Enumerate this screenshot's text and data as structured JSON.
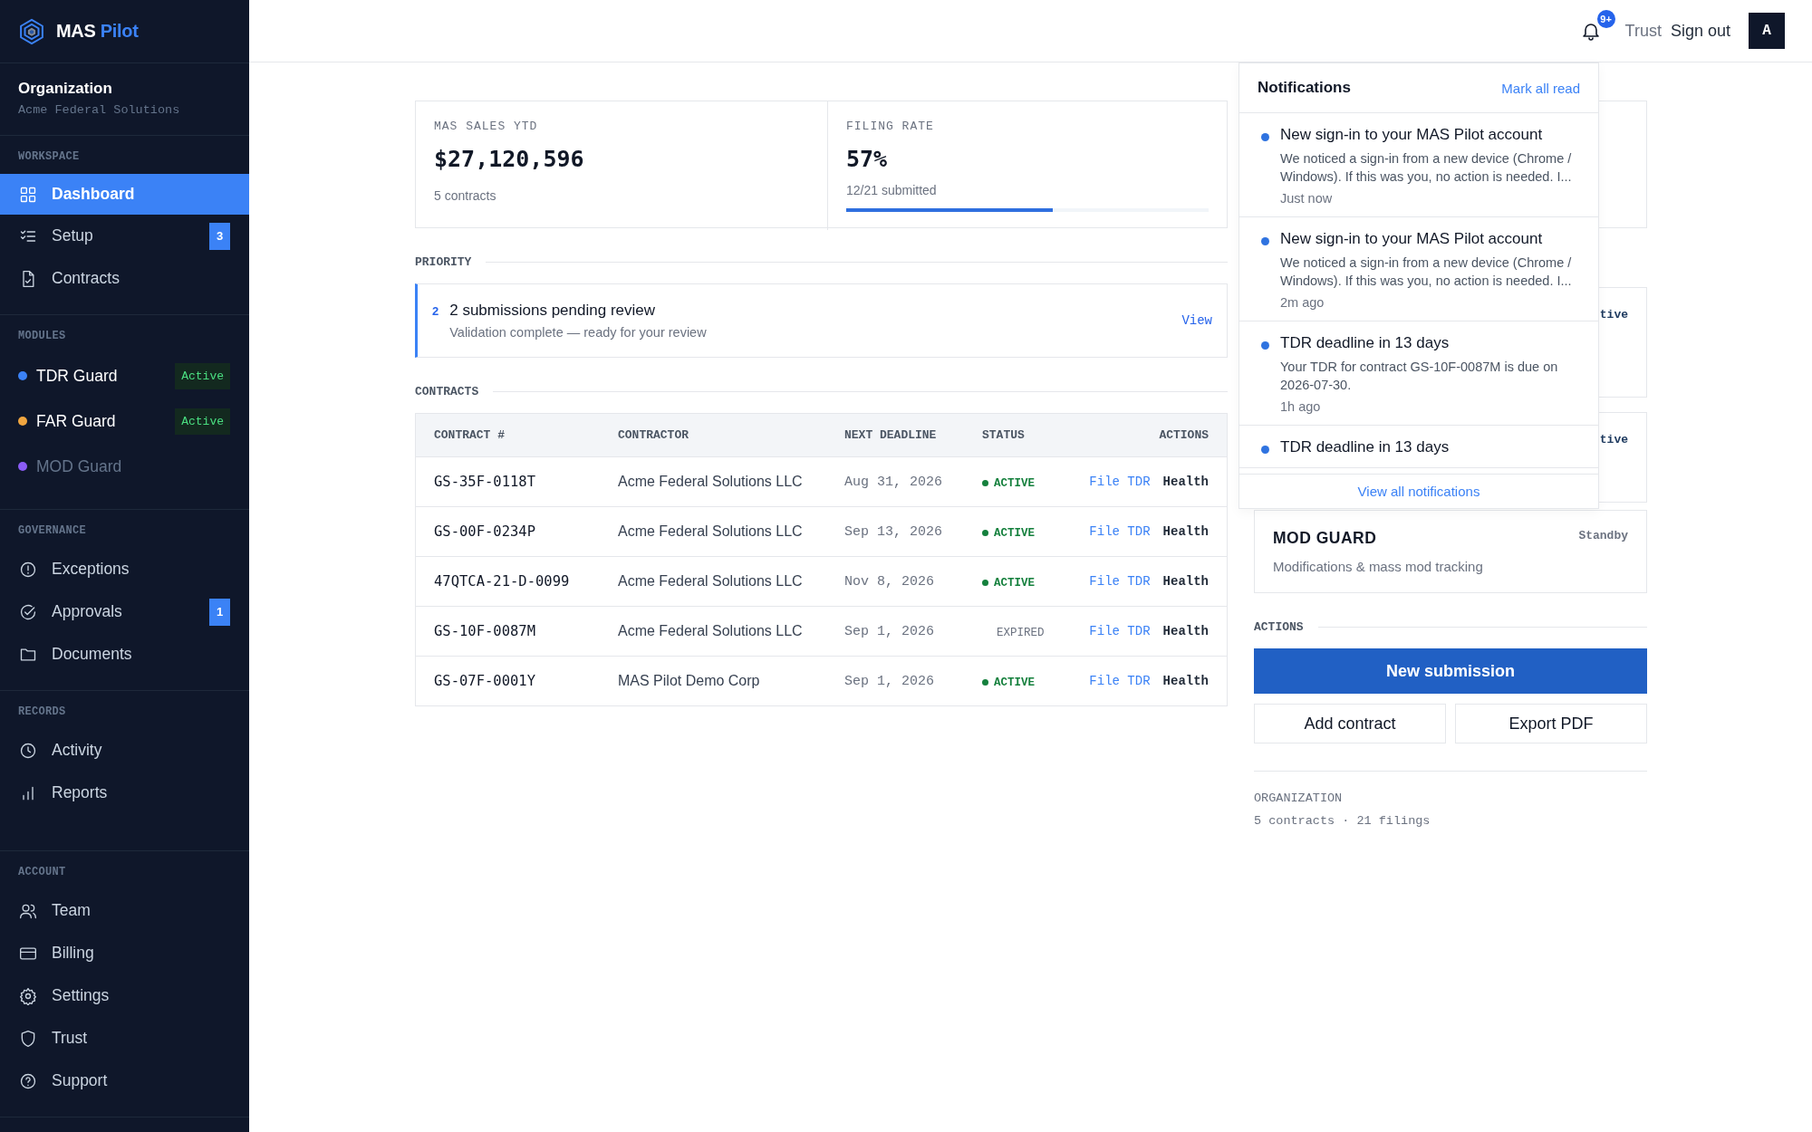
{
  "sidebar": {
    "brand": {
      "first": "MAS",
      "second": "Pilot"
    },
    "organization": {
      "label": "Organization",
      "name": "Acme Federal Solutions"
    },
    "sections": [
      {
        "title": "WORKSPACE",
        "kind": "nav",
        "items": [
          {
            "label": "Dashboard",
            "selected": true
          },
          {
            "label": "Setup",
            "selected": false,
            "badge": "3"
          },
          {
            "label": "Contracts",
            "selected": false
          }
        ]
      },
      {
        "title": "MODULES",
        "kind": "modules",
        "items": [
          {
            "label": "TDR Guard",
            "color": "#3b82f6",
            "disabled": false,
            "badge": "Active"
          },
          {
            "label": "FAR Guard",
            "color": "#f0a640",
            "disabled": false,
            "badge": "Active"
          },
          {
            "label": "MOD Guard",
            "color": "#8b5cf6",
            "disabled": true
          }
        ]
      },
      {
        "title": "GOVERNANCE",
        "kind": "nav",
        "items": [
          {
            "label": "Exceptions",
            "selected": false
          },
          {
            "label": "Approvals",
            "selected": false,
            "badge": "1"
          },
          {
            "label": "Documents",
            "selected": false
          }
        ]
      },
      {
        "title": "RECORDS",
        "kind": "nav",
        "items": [
          {
            "label": "Activity",
            "selected": false
          },
          {
            "label": "Reports",
            "selected": false
          }
        ]
      },
      {
        "title": "ACCOUNT",
        "kind": "nav",
        "items": [
          {
            "label": "Team",
            "selected": false
          },
          {
            "label": "Billing",
            "selected": false
          },
          {
            "label": "Settings",
            "selected": false
          },
          {
            "label": "Trust",
            "selected": false
          },
          {
            "label": "Support",
            "selected": false
          }
        ]
      }
    ]
  },
  "topbar": {
    "notification_count": "9+",
    "links": [
      "Trust",
      "Sign out"
    ],
    "avatar": "A"
  },
  "stats": [
    {
      "label": "MAS SALES YTD",
      "value": "$27,120,596",
      "note": "5 contracts"
    },
    {
      "label": "FILING RATE",
      "value": "57%",
      "note": "12/21 submitted",
      "level": 0.57
    }
  ],
  "priority": {
    "title": "PRIORITY",
    "count": "2",
    "headline": "2 submissions pending review",
    "detail": "Validation complete — ready for your review",
    "action": "View"
  },
  "contracts": {
    "title": "CONTRACTS",
    "columns": [
      "CONTRACT #",
      "CONTRACTOR",
      "NEXT DEADLINE",
      "STATUS",
      "ACTIONS"
    ],
    "rows": [
      {
        "contract": "GS-35F-0118T",
        "contractor": "Acme Federal Solutions LLC",
        "deadline": "Aug 31, 2026",
        "status": "ACTIVE",
        "kind": "active",
        "actions": [
          "File TDR",
          "Health"
        ]
      },
      {
        "contract": "GS-00F-0234P",
        "contractor": "Acme Federal Solutions LLC",
        "deadline": "Sep 13, 2026",
        "status": "ACTIVE",
        "kind": "active",
        "actions": [
          "File TDR",
          "Health"
        ]
      },
      {
        "contract": "47QTCA-21-D-0099",
        "contractor": "Acme Federal Solutions LLC",
        "deadline": "Nov 8, 2026",
        "status": "ACTIVE",
        "kind": "active",
        "actions": [
          "File TDR",
          "Health"
        ]
      },
      {
        "contract": "GS-10F-0087M",
        "contractor": "Acme Federal Solutions LLC",
        "deadline": "Sep 1, 2026",
        "status": "EXPIRED",
        "kind": "expired",
        "actions": [
          "File TDR",
          "Health"
        ]
      },
      {
        "contract": "GS-07F-0001Y",
        "contractor": "MAS Pilot Demo Corp",
        "deadline": "Sep 1, 2026",
        "status": "ACTIVE",
        "kind": "active",
        "actions": [
          "File TDR",
          "Health"
        ]
      }
    ]
  },
  "module_cards": [
    {
      "kind": "covered"
    },
    {
      "kind": "covered",
      "status": "tive"
    },
    {
      "kind": "covered",
      "status": "tive"
    },
    {
      "kind": "full",
      "title": "MOD GUARD",
      "description": "Modifications & mass mod tracking",
      "status": "Standby"
    }
  ],
  "actions": {
    "title": "ACTIONS",
    "primary": "New submission",
    "secondary": [
      "Add contract",
      "Export PDF"
    ]
  },
  "organization_summary": {
    "label": "ORGANIZATION",
    "text": "5 contracts · 21 filings"
  },
  "notifications": {
    "title": "Notifications",
    "mark_all": "Mark all read",
    "footer": "View all notifications",
    "items": [
      {
        "title": "New sign-in to your MAS Pilot account",
        "body": "We noticed a sign-in from a new device (Chrome / Windows). If this was you, no action is needed. I...",
        "time": "Just now",
        "unread": true
      },
      {
        "title": "New sign-in to your MAS Pilot account",
        "body": "We noticed a sign-in from a new device (Chrome / Windows). If this was you, no action is needed. I...",
        "time": "2m ago",
        "unread": true
      },
      {
        "title": "TDR deadline in 13 days",
        "body": "Your TDR for contract GS-10F-0087M is due on 2026-07-30.",
        "time": "1h ago",
        "unread": true
      },
      {
        "title": "TDR deadline in 13 days",
        "unread": true
      }
    ]
  }
}
